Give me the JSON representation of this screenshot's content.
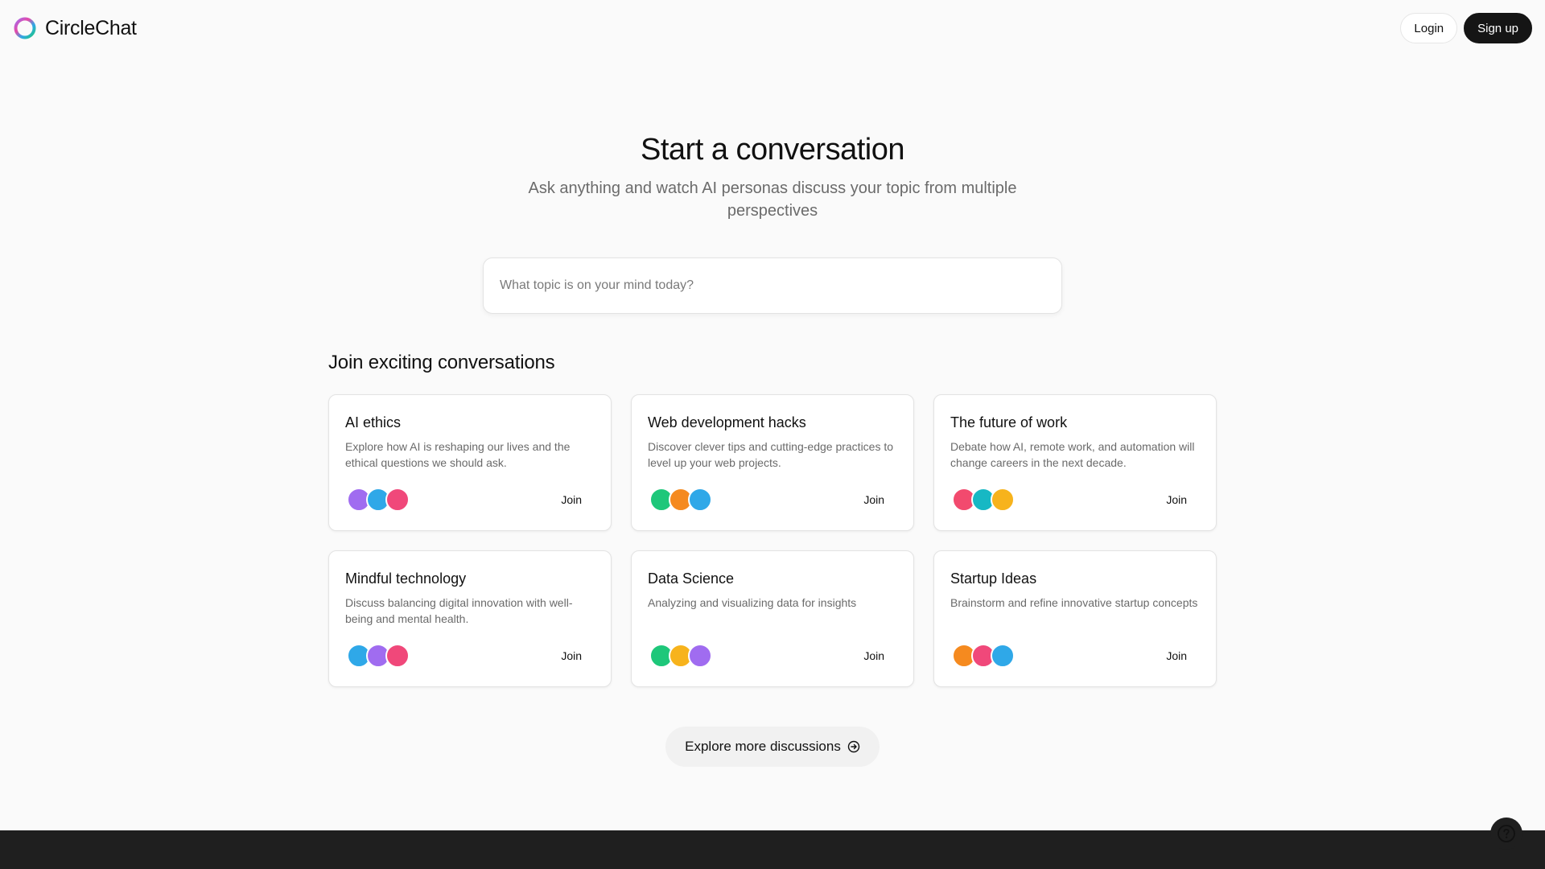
{
  "header": {
    "brand_name": "CircleChat",
    "login_label": "Login",
    "signup_label": "Sign up"
  },
  "hero": {
    "title": "Start a conversation",
    "subtitle": "Ask anything and watch AI personas discuss your topic from multiple perspectives",
    "search_placeholder": "What topic is on your mind today?"
  },
  "conversations": {
    "section_title": "Join exciting conversations",
    "cards": [
      {
        "title": "AI ethics",
        "description": "Explore how AI is reshaping our lives and the ethical questions we should ask.",
        "join_label": "Join",
        "avatar_colors": [
          "#a06cf0",
          "#2fa8e8",
          "#f0487a"
        ]
      },
      {
        "title": "Web development hacks",
        "description": "Discover clever tips and cutting-edge practices to level up your web projects.",
        "join_label": "Join",
        "avatar_colors": [
          "#1ec77a",
          "#f58a1f",
          "#2fa8e8"
        ]
      },
      {
        "title": "The future of work",
        "description": "Debate how AI, remote work, and automation will change careers in the next decade.",
        "join_label": "Join",
        "avatar_colors": [
          "#f24a6e",
          "#17b8c4",
          "#f7b31c"
        ]
      },
      {
        "title": "Mindful technology",
        "description": "Discuss balancing digital innovation with well-being and mental health.",
        "join_label": "Join",
        "avatar_colors": [
          "#2fa8e8",
          "#a06cf0",
          "#f0487a"
        ]
      },
      {
        "title": "Data Science",
        "description": "Analyzing and visualizing data for insights",
        "join_label": "Join",
        "avatar_colors": [
          "#1ec77a",
          "#f7b31c",
          "#a06cf0"
        ]
      },
      {
        "title": "Startup Ideas",
        "description": "Brainstorm and refine innovative startup concepts",
        "join_label": "Join",
        "avatar_colors": [
          "#f58a1f",
          "#f0487a",
          "#2fa8e8"
        ]
      }
    ]
  },
  "explore": {
    "label": "Explore more discussions",
    "icon": "arrow-right-circle-icon"
  },
  "help": {
    "icon": "question-circle-icon"
  }
}
